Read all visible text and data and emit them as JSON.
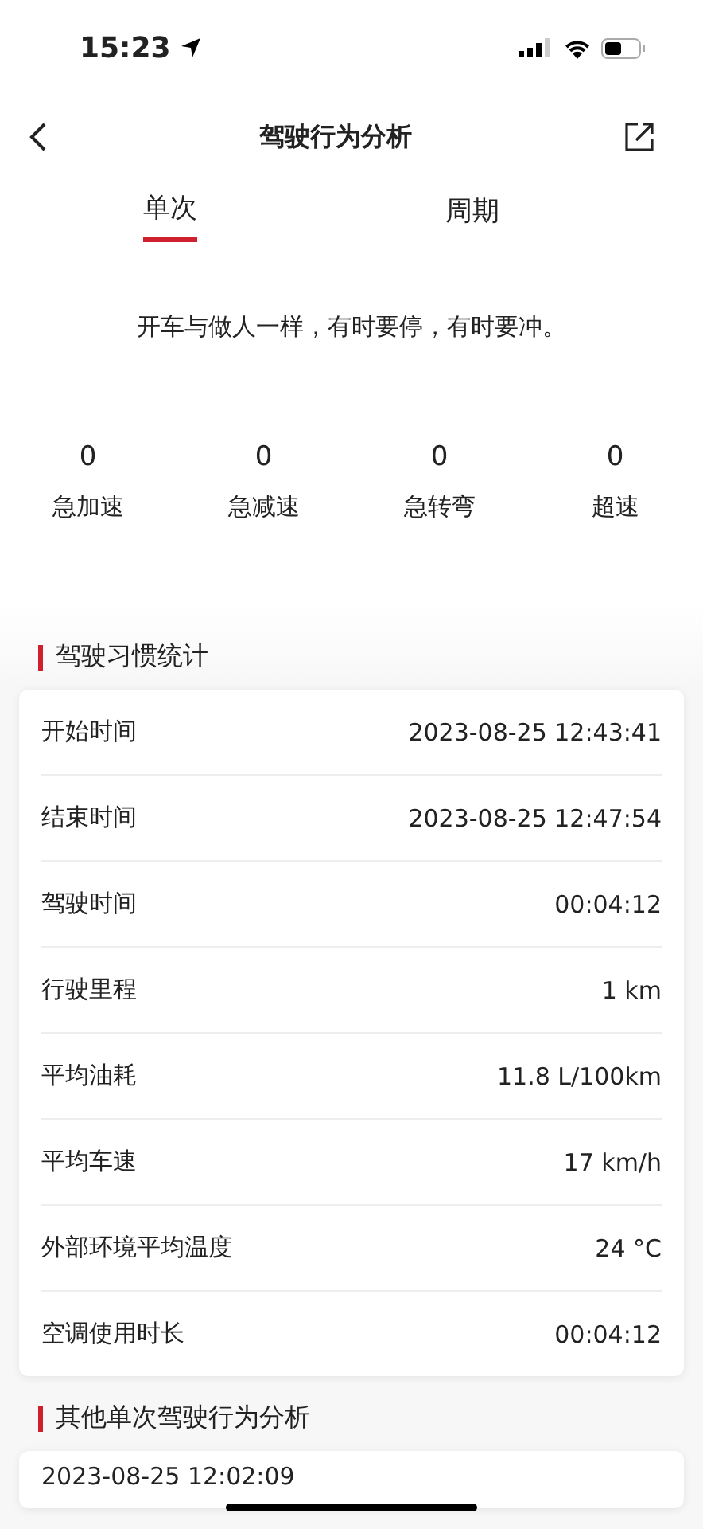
{
  "status_bar": {
    "time": "15:23"
  },
  "nav": {
    "title": "驾驶行为分析"
  },
  "tabs": [
    {
      "label": "单次",
      "selected": true
    },
    {
      "label": "周期",
      "selected": false
    }
  ],
  "motto": "开车与做人一样，有时要停，有时要冲。",
  "events": [
    {
      "count": "0",
      "label": "急加速"
    },
    {
      "count": "0",
      "label": "急减速"
    },
    {
      "count": "0",
      "label": "急转弯"
    },
    {
      "count": "0",
      "label": "超速"
    }
  ],
  "habits": {
    "title": "驾驶习惯统计",
    "rows": [
      {
        "label": "开始时间",
        "value": "2023-08-25 12:43:41"
      },
      {
        "label": "结束时间",
        "value": "2023-08-25 12:47:54"
      },
      {
        "label": "驾驶时间",
        "value": "00:04:12"
      },
      {
        "label": "行驶里程",
        "value": "1 km"
      },
      {
        "label": "平均油耗",
        "value": "11.8 L/100km"
      },
      {
        "label": "平均车速",
        "value": "17 km/h"
      },
      {
        "label": "外部环境平均温度",
        "value": "24 °C"
      },
      {
        "label": "空调使用时长",
        "value": "00:04:12"
      }
    ]
  },
  "others": {
    "title": "其他单次驾驶行为分析",
    "items": [
      {
        "time": "2023-08-25 12:02:09"
      }
    ]
  }
}
